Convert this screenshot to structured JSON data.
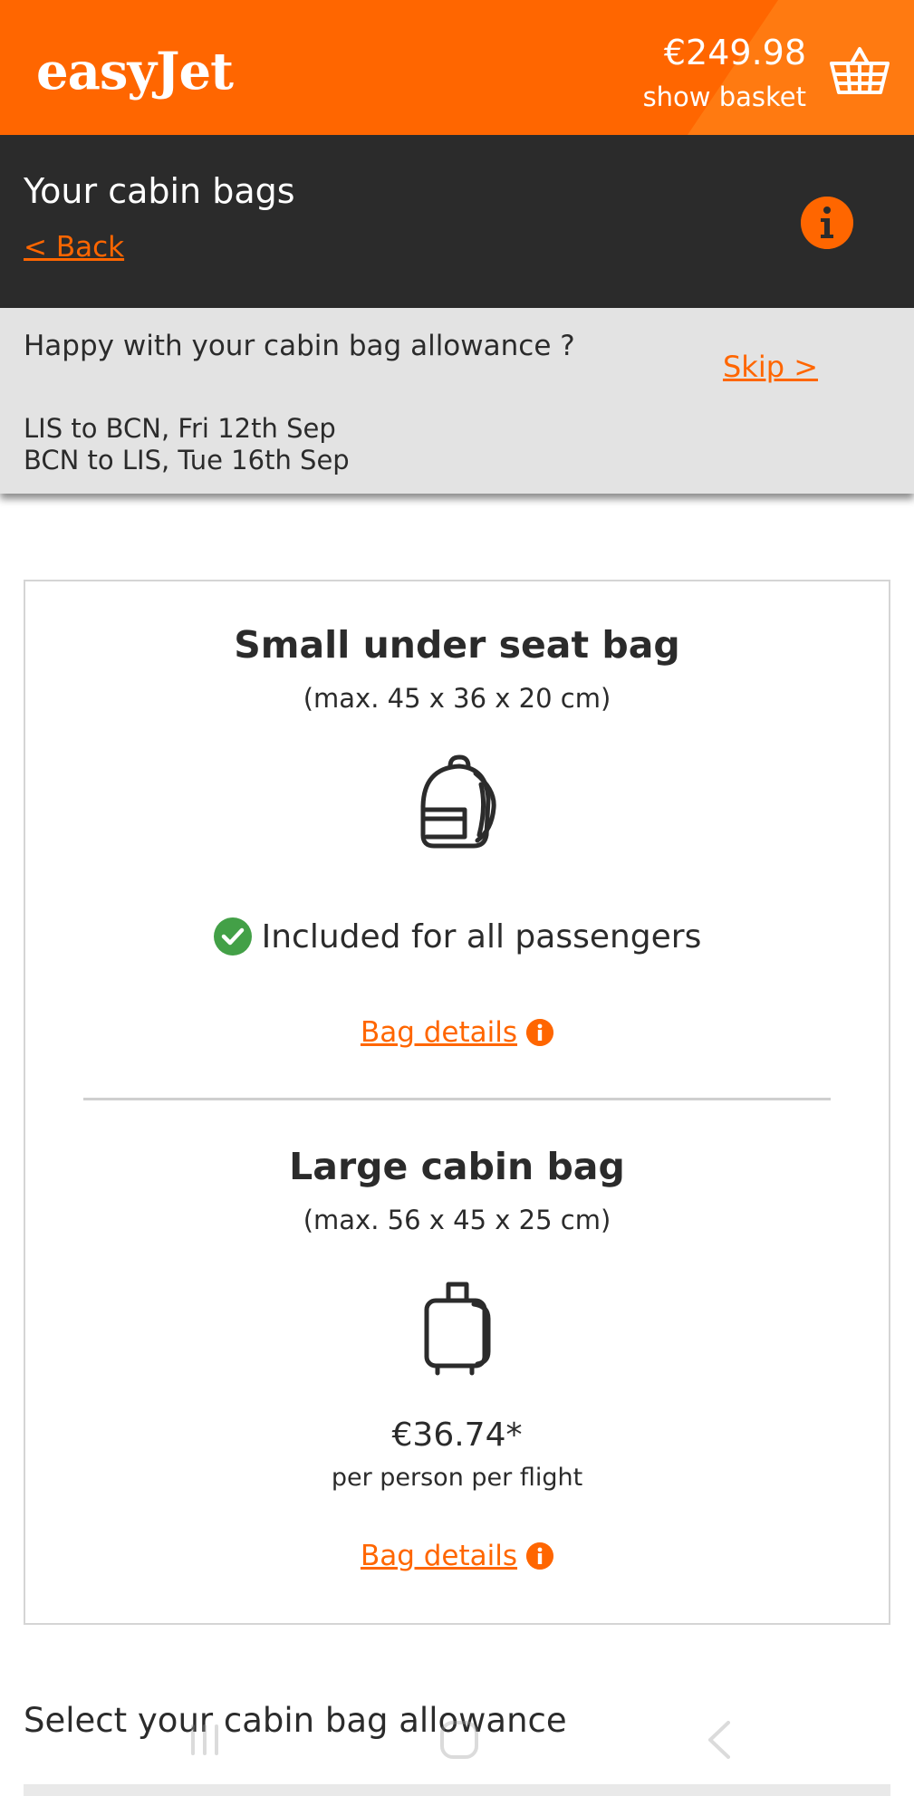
{
  "header": {
    "logo": "easyJet",
    "price": "€249.98",
    "show_basket": "show basket",
    "basket_icon": "basket-icon"
  },
  "titlebar": {
    "title": "Your cabin bags",
    "back": "< Back",
    "info_icon": "info-icon"
  },
  "skip_band": {
    "question": "Happy with your cabin bag allowance ?",
    "route_outbound": "LIS to BCN, Fri 12th Sep",
    "route_return": "BCN to LIS, Tue 16th Sep",
    "skip": "Skip >"
  },
  "bags": [
    {
      "title": "Small under seat bag",
      "dimensions": "(max. 45 x 36 x 20 cm)",
      "icon": "backpack-icon",
      "included": "Included for all passengers",
      "details": "Bag details"
    },
    {
      "title": "Large cabin bag",
      "dimensions": "(max. 56 x 45 x 25 cm)",
      "icon": "suitcase-icon",
      "price": "€36.74*",
      "price_note": "per person per flight",
      "details": "Bag details"
    }
  ],
  "select_heading": "Select your cabin bag allowance",
  "colors": {
    "brand_orange": "#ff6600",
    "dark": "#2b2b2b",
    "band_grey": "#e3e3e3",
    "check_green": "#43a047"
  }
}
